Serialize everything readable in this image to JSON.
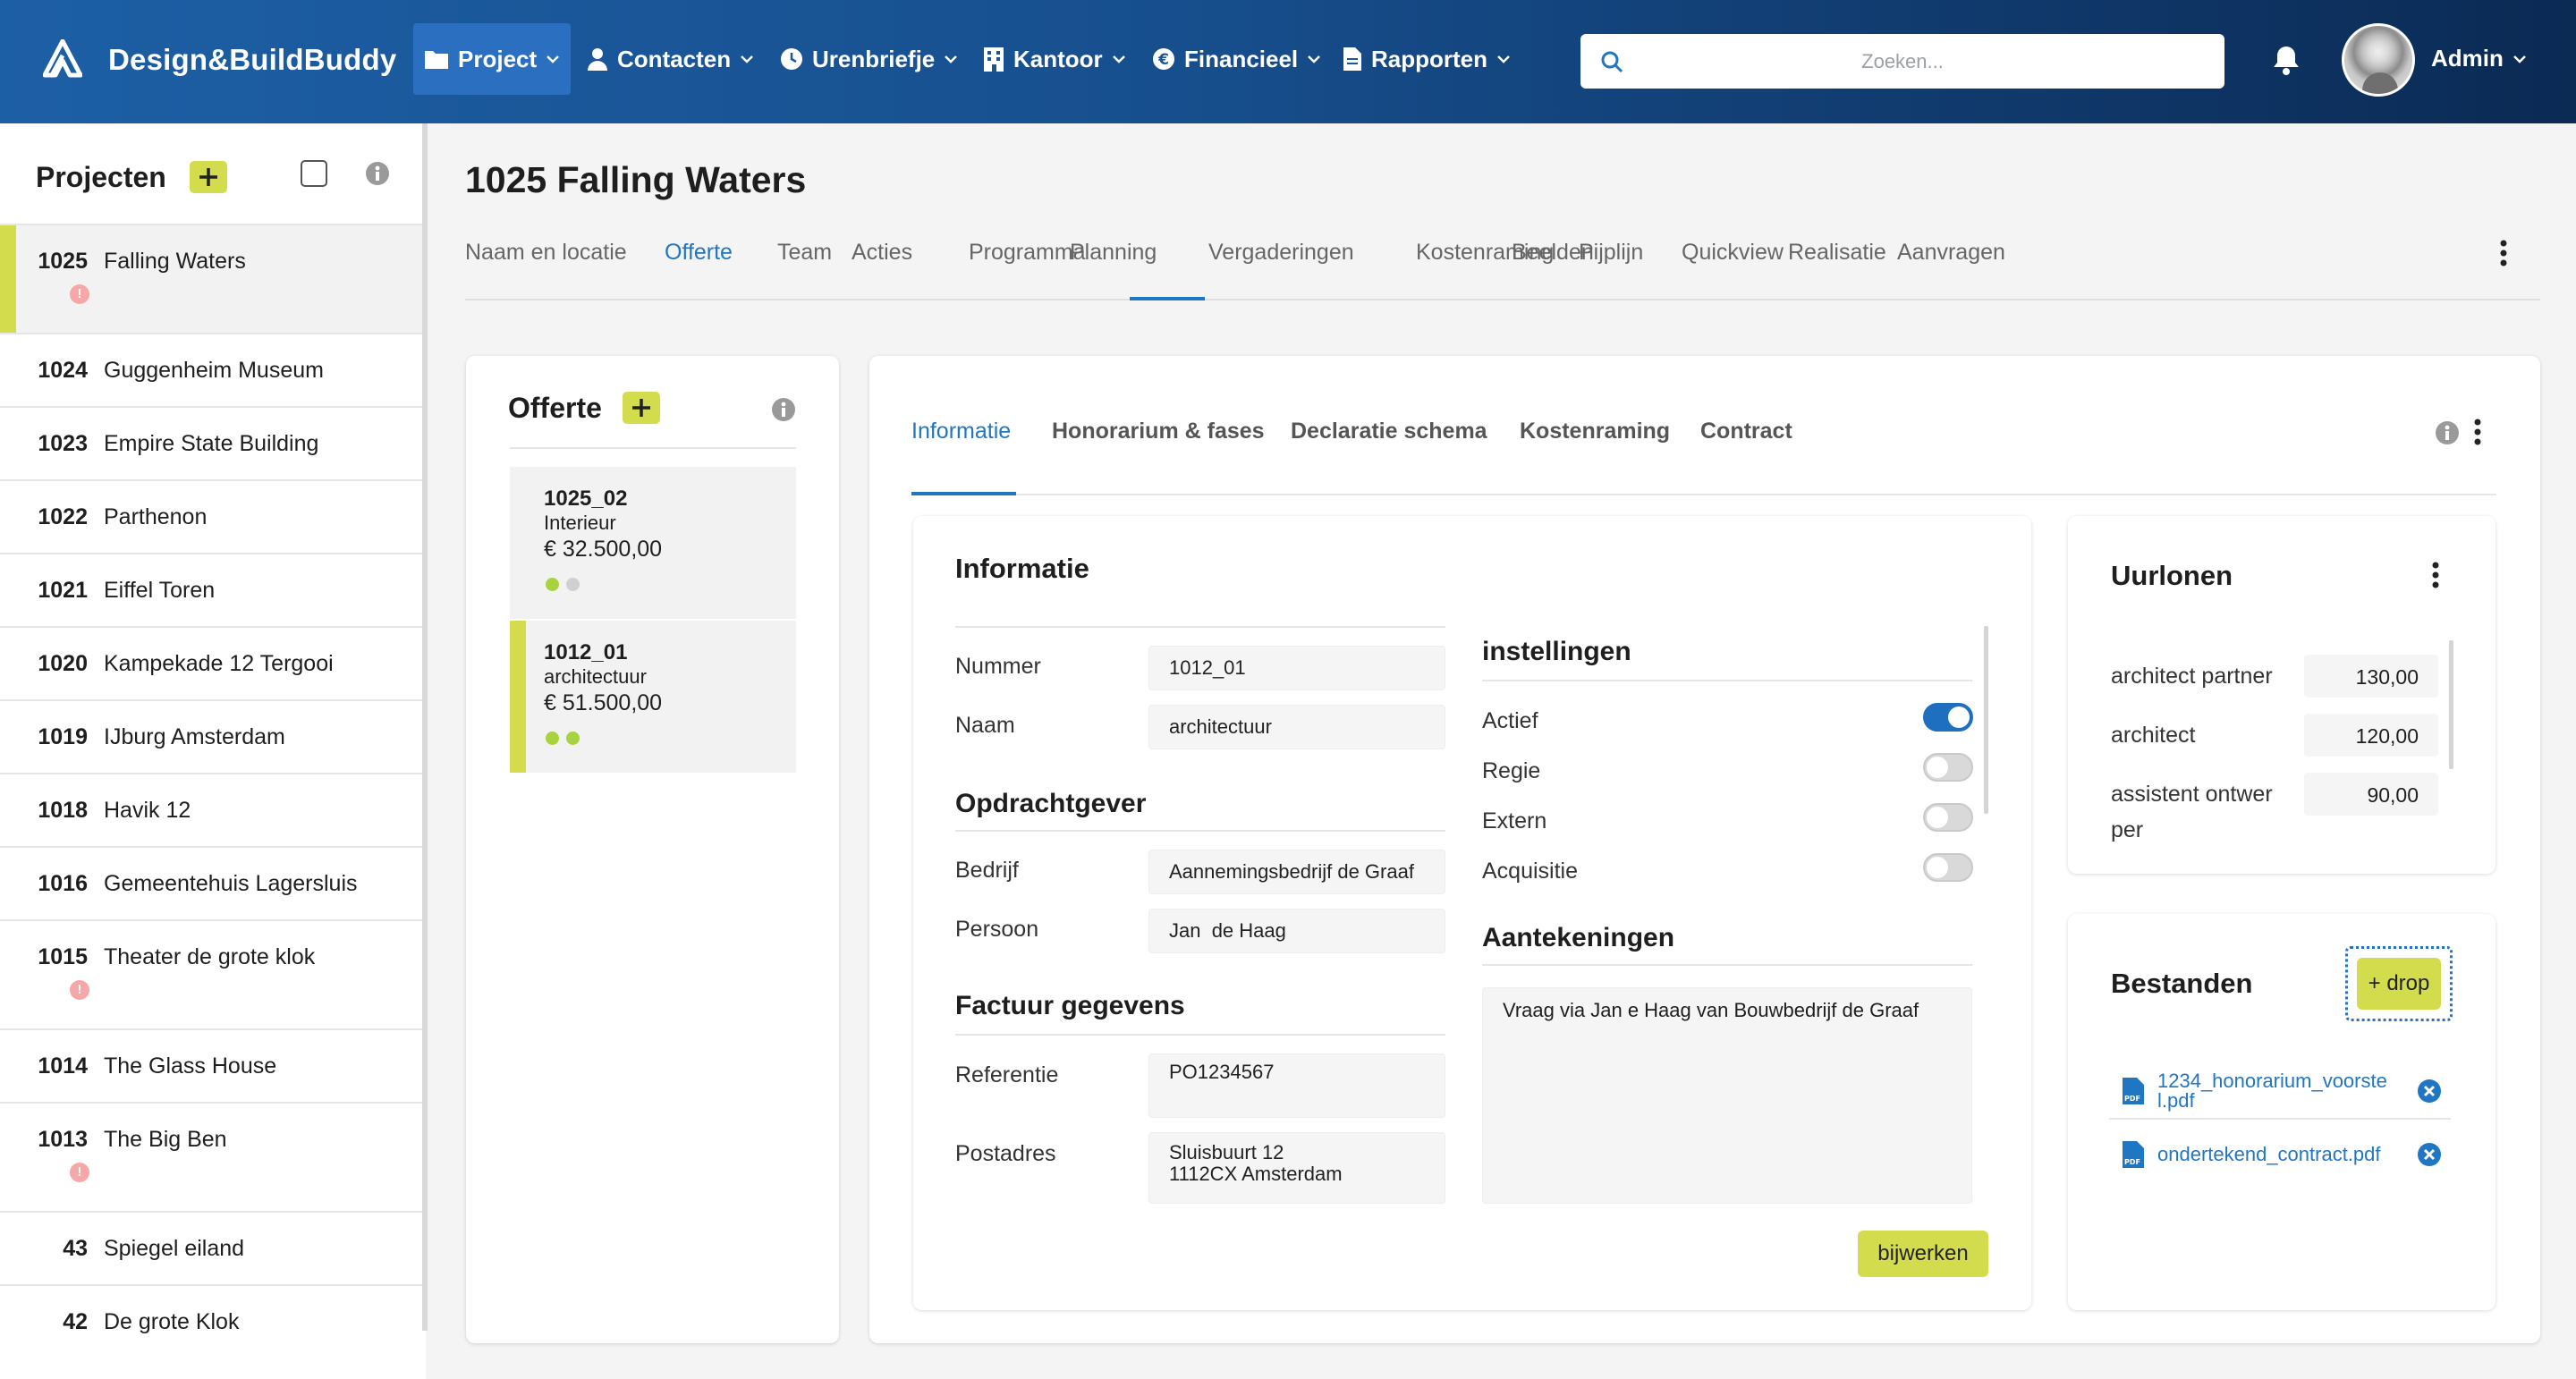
{
  "app": {
    "title": "Design&BuildBuddy"
  },
  "nav": {
    "items": [
      {
        "label": "Project",
        "icon": "folder-icon",
        "active": true
      },
      {
        "label": "Contacten",
        "icon": "person-icon"
      },
      {
        "label": "Urenbriefje",
        "icon": "clock-icon"
      },
      {
        "label": "Kantoor",
        "icon": "building-icon"
      },
      {
        "label": "Financieel",
        "icon": "euro-icon"
      },
      {
        "label": "Rapporten",
        "icon": "document-icon"
      }
    ],
    "search_placeholder": "Zoeken...",
    "user": "Admin"
  },
  "sidebar": {
    "title": "Projecten",
    "projects": [
      {
        "num": "1025",
        "name": "Falling Waters",
        "selected": true,
        "alert": true
      },
      {
        "num": "1024",
        "name": "Guggenheim Museum"
      },
      {
        "num": "1023",
        "name": "Empire State Building"
      },
      {
        "num": "1022",
        "name": "Parthenon"
      },
      {
        "num": "1021",
        "name": "Eiffel Toren"
      },
      {
        "num": "1020",
        "name": "Kampekade 12 Tergooi"
      },
      {
        "num": "1019",
        "name": "IJburg Amsterdam"
      },
      {
        "num": "1018",
        "name": "Havik 12"
      },
      {
        "num": "1016",
        "name": "Gemeentehuis Lagersluis"
      },
      {
        "num": "1015",
        "name": "Theater de grote klok",
        "alert": true
      },
      {
        "num": "1014",
        "name": "The Glass House"
      },
      {
        "num": "1013",
        "name": "The Big Ben",
        "alert": true
      },
      {
        "num": "43",
        "name": "Spiegel eiland"
      },
      {
        "num": "42",
        "name": "De grote Klok"
      }
    ],
    "alert_glyph": "!"
  },
  "project": {
    "title": "1025 Falling Waters",
    "tabs": [
      "Naam en locatie",
      "Offerte",
      "Team",
      "Acties",
      "Programma",
      "Planning",
      "Vergaderingen",
      "Kostenraming",
      "Beelden",
      "Pijplijn",
      "Quickview",
      "Realisatie",
      "Aanvragen"
    ],
    "active_tab": "Offerte"
  },
  "offerte": {
    "title": "Offerte",
    "quotes": [
      {
        "code": "1025_02",
        "type": "Interieur",
        "amount": "€ 32.500,00",
        "dots": [
          "#a6d33e",
          "#d0d0d0"
        ]
      },
      {
        "code": "1012_01",
        "type": "architectuur",
        "amount": "€ 51.500,00",
        "dots": [
          "#a6d33e",
          "#a6d33e"
        ],
        "selected": true
      }
    ]
  },
  "subtabs": {
    "items": [
      "Informatie",
      "Honorarium & fases",
      "Declaratie schema",
      "Kostenraming",
      "Contract"
    ],
    "active": "Informatie"
  },
  "informatie": {
    "title": "Informatie",
    "nummer_label": "Nummer",
    "nummer": "1012_01",
    "naam_label": "Naam",
    "naam": "architectuur",
    "opdrachtgever_title": "Opdrachtgever",
    "bedrijf_label": "Bedrijf",
    "bedrijf": "Aannemingsbedrijf de Graaf",
    "persoon_label": "Persoon",
    "persoon": "Jan  de Haag",
    "factuur_title": "Factuur gegevens",
    "referentie_label": "Referentie",
    "referentie": "PO1234567",
    "postadres_label": "Postadres",
    "postadres": "Sluisbuurt 12\n1112CX Amsterdam",
    "instellingen_title": "instellingen",
    "toggles": [
      {
        "label": "Actief",
        "on": true
      },
      {
        "label": "Regie",
        "on": false
      },
      {
        "label": "Extern",
        "on": false
      },
      {
        "label": "Acquisitie",
        "on": false
      }
    ],
    "aantekeningen_title": "Aantekeningen",
    "aantekeningen": "Vraag via Jan e Haag van Bouwbedrijf de Graaf",
    "update_button": "bijwerken"
  },
  "uurlonen": {
    "title": "Uurlonen",
    "rates": [
      {
        "role": "architect partner",
        "value": "130,00"
      },
      {
        "role": "architect",
        "value": "120,00"
      },
      {
        "role": "assistent ontwer\nper",
        "value": "90,00"
      }
    ]
  },
  "bestanden": {
    "title": "Bestanden",
    "drop_label": "+ drop",
    "files": [
      "1234_honorarium_voorste\nl.pdf",
      "ondertekend_contract.pdf"
    ]
  },
  "colors": {
    "accent": "#d3dc4d",
    "primary": "#2176c4",
    "alert": "#f6a7a7"
  }
}
